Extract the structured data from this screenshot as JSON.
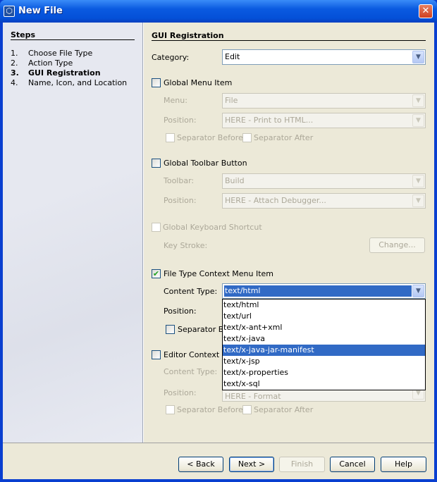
{
  "window": {
    "title": "New File",
    "icon": "netbeans-cube-icon",
    "close_icon": "close-icon"
  },
  "steps": {
    "heading": "Steps",
    "items": [
      {
        "num": "1.",
        "label": "Choose File Type"
      },
      {
        "num": "2.",
        "label": "Action Type"
      },
      {
        "num": "3.",
        "label": "GUI Registration",
        "current": true
      },
      {
        "num": "4.",
        "label": "Name, Icon, and Location"
      }
    ]
  },
  "main": {
    "heading": "GUI Registration",
    "category": {
      "label": "Category:",
      "value": "Edit"
    },
    "global_menu": {
      "label": "Global Menu Item",
      "checked": false,
      "menu_label": "Menu:",
      "menu_value": "File",
      "position_label": "Position:",
      "position_value": "HERE - Print to HTML...",
      "sep_before": "Separator Before",
      "sep_after": "Separator After"
    },
    "global_toolbar": {
      "label": "Global Toolbar Button",
      "checked": false,
      "toolbar_label": "Toolbar:",
      "toolbar_value": "Build",
      "position_label": "Position:",
      "position_value": "HERE - Attach Debugger..."
    },
    "keyboard": {
      "label": "Global Keyboard Shortcut",
      "checked": false,
      "keystroke_label": "Key Stroke:",
      "change_button": "Change..."
    },
    "file_type_context": {
      "label": "File Type Context Menu Item",
      "checked": true,
      "content_type_label": "Content Type:",
      "content_type_value": "text/html",
      "position_label": "Position:",
      "sep_before": "Separator Be"
    },
    "editor_context": {
      "label": "Editor Context Me",
      "checked": false,
      "content_type_label": "Content Type:",
      "position_label": "Position:",
      "position_value": "HERE - Format",
      "sep_before": "Separator Before",
      "sep_after": "Separator After"
    },
    "dropdown": {
      "options": [
        "text/html",
        "text/url",
        "text/x-ant+xml",
        "text/x-java",
        "text/x-java-jar-manifest",
        "text/x-jsp",
        "text/x-properties",
        "text/x-sql"
      ],
      "highlighted": "text/x-java-jar-manifest"
    }
  },
  "buttons": {
    "back": "< Back",
    "next": "Next >",
    "finish": "Finish",
    "cancel": "Cancel",
    "help": "Help"
  },
  "colors": {
    "selection": "#316ac5",
    "titlebar": "#0a5ae0"
  }
}
